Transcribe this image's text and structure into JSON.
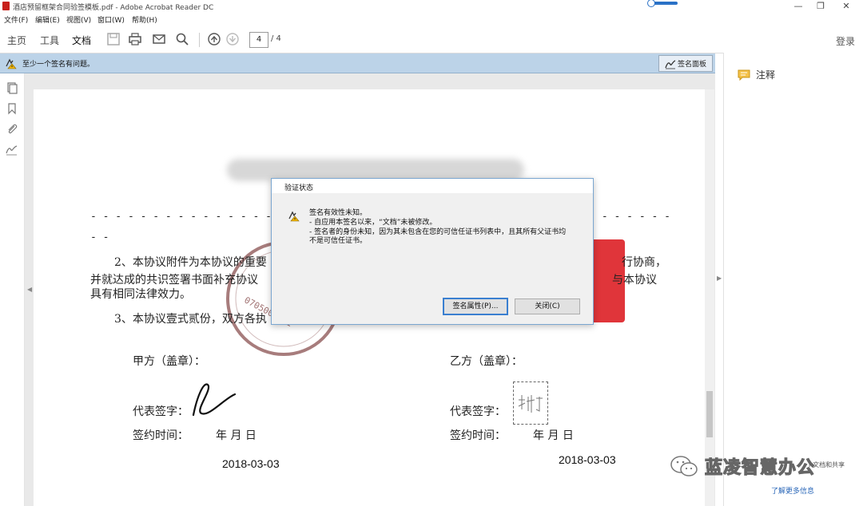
{
  "window": {
    "title": "酒店预留框架合同验签模板.pdf - Adobe Acrobat Reader DC",
    "minimize": "—",
    "restore": "❐",
    "close": "✕"
  },
  "menu": {
    "items": [
      "文件(F)",
      "编辑(E)",
      "视图(V)",
      "窗口(W)",
      "帮助(H)"
    ]
  },
  "toolbar": {
    "tabs": [
      "主页",
      "工具",
      "文档"
    ],
    "page_current": "4",
    "page_total": "/ 4",
    "login": "登录"
  },
  "sigbar": {
    "message": "至少一个签名有问题。",
    "panel_button": "签名面板"
  },
  "right_pane": {
    "annotation_label": "注释",
    "learn_more": "了解更多信息",
    "clipped_text": "n文档和共享"
  },
  "document": {
    "dashes_line1": "- - - - - - - - - - - - - - - - - - - - -",
    "dashes_line1b": "- - - - - - - - - - - - - - -",
    "dashes_line2": "- -",
    "para2_a": "2、本协议附件为本协议的重要",
    "para2_a_right": "行协商，",
    "para2_b": "并就达成的共识签署书面补充协议",
    "para2_b_right": "与本协议",
    "para2_c": "具有相同法律效力。",
    "para3": "3、本协议壹式贰份，双方各执",
    "party_a": "甲方（盖章）：",
    "party_b": "乙方（盖章）：",
    "rep_a": "代表签字：",
    "rep_b": "代表签字：",
    "time_a": "签约时间：",
    "time_b": "签约时间：",
    "ymd_a": "年     月        日",
    "ymd_b": "年     月        日",
    "date_a": "2018-03-03",
    "date_b": "2018-03-03",
    "seal_text": "0705005811"
  },
  "dialog": {
    "title": "验证状态",
    "line1": "签名有效性未知。",
    "line2": "- 自应用本签名以来，“文档”未被修改。",
    "line3": "- 签名者的身份未知，因为其未包含在您的可信任证书列表中，且其所有父证书均",
    "line4": "不是可信任证书。",
    "properties_button": "签名属性(P)...",
    "close_button": "关闭(C)"
  },
  "watermark": {
    "text": "蓝凌智慧办公"
  },
  "colors": {
    "accent": "#2a71c6",
    "sigbar": "#bcd3e8",
    "seal_red": "#e0353a",
    "stamp": "#8a5050"
  }
}
